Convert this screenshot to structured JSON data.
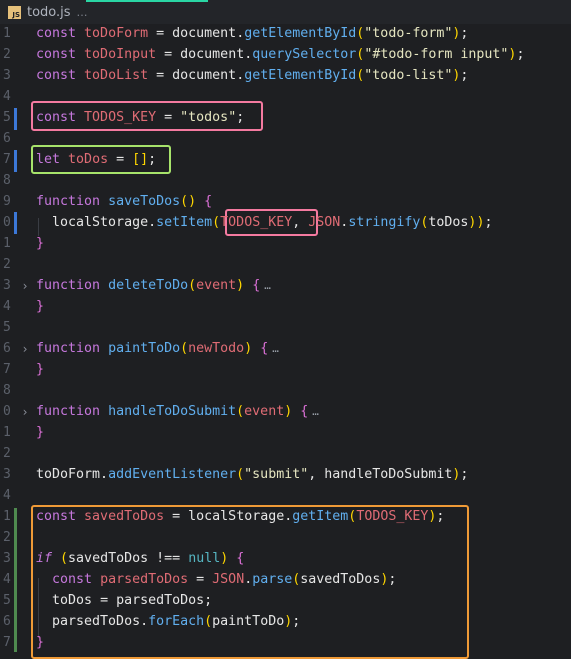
{
  "tab": {
    "name": "todo.js",
    "icon": "js-file-icon",
    "icon_text": "JS",
    "breadcrumb": "…"
  },
  "lines": [
    {
      "n": "1",
      "code": "const toDoForm = document.getElementById(\"todo-form\");"
    },
    {
      "n": "2",
      "code": "const toDoInput = document.querySelector(\"#todo-form input\");"
    },
    {
      "n": "3",
      "code": "const toDoList = document.getElementById(\"todo-list\");"
    },
    {
      "n": "4",
      "code": ""
    },
    {
      "n": "5",
      "code": "const TODOS_KEY = \"todos\";"
    },
    {
      "n": "6",
      "code": ""
    },
    {
      "n": "7",
      "code": "let toDos = [];"
    },
    {
      "n": "8",
      "code": ""
    },
    {
      "n": "9",
      "code": "function saveToDos() {"
    },
    {
      "n": "0",
      "code": "  localStorage.setItem(TODOS_KEY, JSON.stringify(toDos));"
    },
    {
      "n": "1",
      "code": "}"
    },
    {
      "n": "2",
      "code": ""
    },
    {
      "n": "3",
      "code": "function deleteToDo(event) {…"
    },
    {
      "n": "4",
      "code": "}"
    },
    {
      "n": "5",
      "code": ""
    },
    {
      "n": "6",
      "code": "function paintToDo(newTodo) {…"
    },
    {
      "n": "7",
      "code": "}"
    },
    {
      "n": "8",
      "code": ""
    },
    {
      "n": "0",
      "code": "function handleToDoSubmit(event) {…"
    },
    {
      "n": "1",
      "code": "}"
    },
    {
      "n": "2",
      "code": ""
    },
    {
      "n": "3",
      "code": "toDoForm.addEventListener(\"submit\", handleToDoSubmit);"
    },
    {
      "n": "4",
      "code": ""
    },
    {
      "n": "1",
      "code": "const savedToDos = localStorage.getItem(TODOS_KEY);"
    },
    {
      "n": "2",
      "code": ""
    },
    {
      "n": "3",
      "code": "if (savedToDos !== null) {"
    },
    {
      "n": "4",
      "code": "  const parsedToDos = JSON.parse(savedToDos);"
    },
    {
      "n": "5",
      "code": "  toDos = parsedToDos;"
    },
    {
      "n": "6",
      "code": "  parsedToDos.forEach(paintToDo);"
    },
    {
      "n": "7",
      "code": "}"
    }
  ],
  "fold_marker": "…",
  "colors": {
    "highlight_pink": "#f47aa0",
    "highlight_green": "#a7e36b",
    "highlight_orange": "#ef9a37"
  }
}
